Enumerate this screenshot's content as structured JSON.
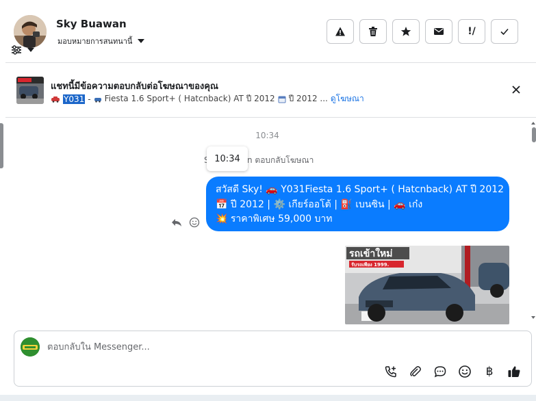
{
  "header": {
    "user_name": "Sky Buawan",
    "assign_label": "มอบหมายการสนทนานี้",
    "actions": [
      {
        "name": "report-icon"
      },
      {
        "name": "trash-icon"
      },
      {
        "name": "star-icon"
      },
      {
        "name": "mail-icon"
      },
      {
        "name": "follow-up-icon",
        "glyph": "!/"
      },
      {
        "name": "check-icon"
      }
    ]
  },
  "banner": {
    "title": "แชทนี้มีข้อความตอบกลับต่อโฆษณาของคุณ",
    "code": "Y031",
    "separator": "-",
    "details": "Fiesta 1.6 Sport+ ( Hatcnback) AT ปี 2012",
    "details_2": "ปี 2012 ...",
    "link": "ดูโฆษณา"
  },
  "chat": {
    "time": "10:34",
    "tooltip_time": "10:34",
    "replied_note_start": "S",
    "replied_note_end": "an ตอบกลับโฆษณา",
    "message_lines": [
      "สวัสดี Sky! 🚗 Y031Fiesta 1.6 Sport+ ( Hatcnback) AT ปี 2012",
      "📅 ปี 2012 | ⚙️ เกียร์ออโต้ | ⛽ เบนซิน | 🚗 เก๋ง",
      "💥 ราคาพิเศษ 59,000 บาท"
    ],
    "image_banner_text": "รถเข้าใหม่",
    "image_banner_sub": "รับรถเพียง 1999."
  },
  "composer": {
    "placeholder": "ตอบกลับใน Messenger...",
    "tools": [
      "call-add-icon",
      "attachment-icon",
      "saved-reply-icon",
      "emoji-icon",
      "baht-icon",
      "thumbs-up-icon"
    ],
    "baht_glyph": "฿"
  },
  "colors": {
    "bubble": "#0a7cff",
    "link": "#1b74e4",
    "highlight": "#1b66c9"
  }
}
